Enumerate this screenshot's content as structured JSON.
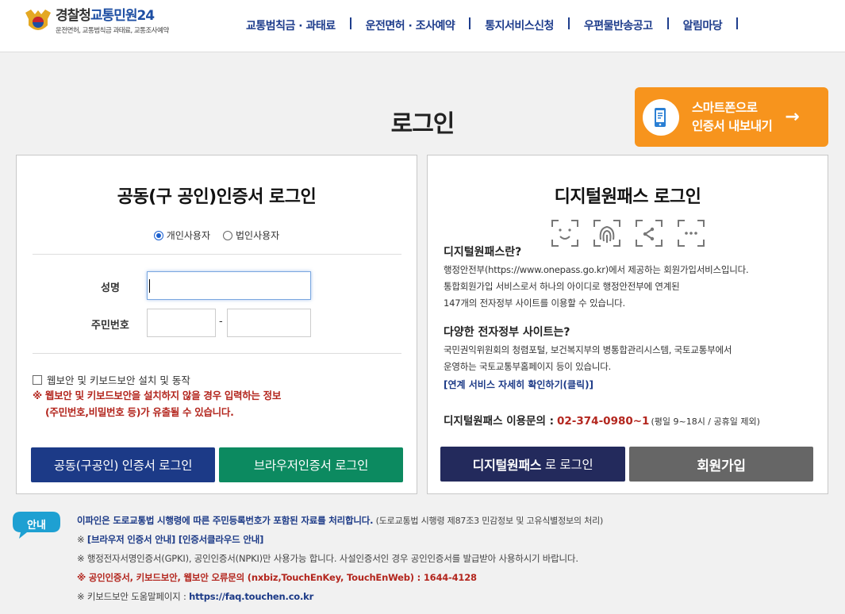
{
  "header": {
    "logo_title_a": "경찰청",
    "logo_title_b": "교통민원24",
    "logo_sub": "운전면허, 교통범칙금 과태료, 교통조사예약",
    "nav": [
      "교통범칙금 · 과태료",
      "운전면허 · 조사예약",
      "통지서비스신청",
      "우편물반송공고",
      "알림마당"
    ]
  },
  "page": {
    "title": "로그인",
    "smart_line1": "스마트폰으로",
    "smart_line2": "인증서 내보내기",
    "smart_arrow": "→"
  },
  "left": {
    "title": "공동(구 공인)인증서 로그인",
    "radio_individual": "개인사용자",
    "radio_corporate": "법인사용자",
    "name_label": "성명",
    "rrn_label": "주민번호",
    "rrn_dash": "-",
    "check_label": "웹보안 및 키보드보안 설치 및 동작",
    "warn1": "※ 웹보안 및 키보드보안을 설치하지 않을 경우 입력하는 정보",
    "warn2": "(주민번호,비밀번호 등)가 유출될 수 있습니다.",
    "btn_cert": "공동(구공인) 인증서 로그인",
    "btn_browser": "브라우저인증서 로그인"
  },
  "right": {
    "title": "디지털원패스 로그인",
    "q1": "디지털원패스란?",
    "a1_1": "행정안전부(https://www.onepass.go.kr)에서 제공하는 회원가입서비스입니다.",
    "a1_2": "통합회원가입 서비스로서 하나의 아이디로 행정안전부에 연계된",
    "a1_3": "147개의 전자정부 사이트를 이용할 수 있습니다.",
    "q2": "다양한 전자정부 사이트는?",
    "a2_1": "국민권익위원회의 청렴포털, 보건복지부의 병통합관리시스템, 국토교통부에서",
    "a2_2": "운영하는 국토교통부홈페이지 등이 있습니다.",
    "link": "[연계 서비스 자세히 확인하기(클릭)]",
    "inquiry_label": "디지털원패스 이용문의 :",
    "inquiry_phone": "02-374-0980~1",
    "inquiry_note": "(평일 9~18시 / 공휴일 제외)",
    "btn_login_bold": "디지털원패스",
    "btn_login_rest": " 로 로그인",
    "btn_join": "회원가입"
  },
  "notice": {
    "badge": "안내",
    "line1_bold": "이파인은 도로교통법 시행령에 따른 주민등록번호가 포함된 자료를 처리합니다.",
    "line1_rest": " (도로교통법 시행령 제87조3 민감정보 및 고유식별정보의 처리)",
    "line2_prefix": "※ ",
    "line2_link1": "[브라우저 인증서 안내]",
    "line2_link2": " [인증서클라우드 안내]",
    "line3": "※ 행정전자서명인증서(GPKI), 공인인증서(NPKI)만 사용가능 합니다. 사설인증서인 경우 공인인증서를 발급받아 사용하시기 바랍니다.",
    "line4": "※ 공인인증서, 키보드보안, 웹보안 오류문의 (nxbiz,TouchEnKey, TouchEnWeb) : 1644-4128",
    "line5_prefix": "※ 키보드보안 도움말페이지 : ",
    "line5_link": "https://faq.touchen.co.kr"
  }
}
